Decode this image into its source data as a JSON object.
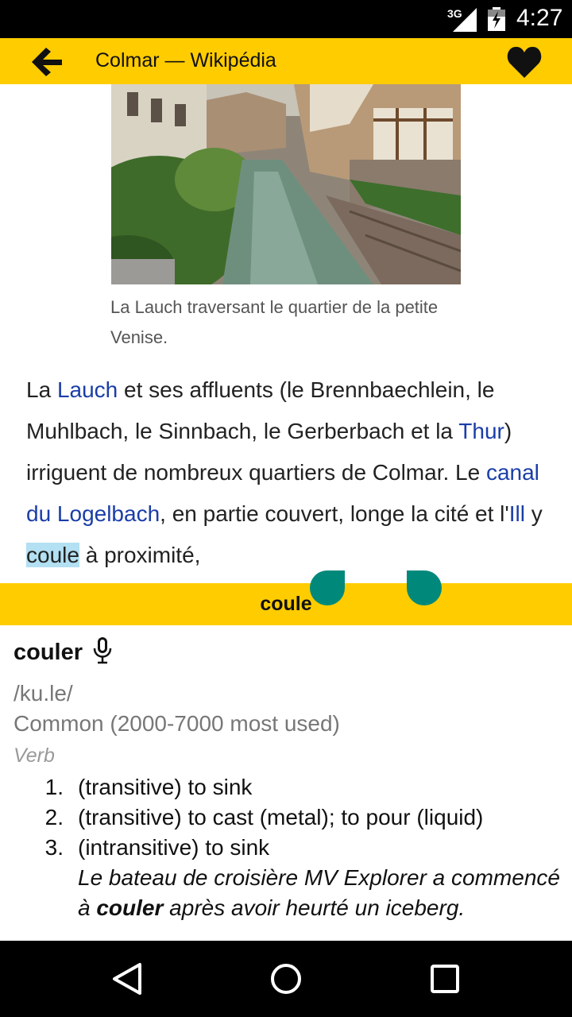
{
  "status_bar": {
    "network": "3G",
    "time": "4:27"
  },
  "toolbar": {
    "title": "Colmar — Wikipédia"
  },
  "article": {
    "caption": "La Lauch traversant le quartier de la petite Venise.",
    "para": {
      "t1": "La ",
      "link1": "Lauch",
      "t2": " et ses affluents (le Brennbaechlein, le Muhlbach, le Sinnbach, le Gerberbach et la ",
      "link2": "Thur",
      "t3": ") irriguent de nombreux quartiers de Colmar. Le ",
      "link3": "canal du Logelbach",
      "t4": ", en partie couvert, longe la cité et l'",
      "link4": "Ill",
      "t5": " y ",
      "selected": "coule",
      "t6": " à proximité,"
    }
  },
  "dictionary": {
    "query": "coule",
    "headword": "couler",
    "pronunciation": "/ku.le/",
    "frequency": "Common (2000-7000 most used)",
    "part_of_speech": "Verb",
    "definitions": [
      {
        "num": "1.",
        "text": "(transitive) to sink"
      },
      {
        "num": "2.",
        "text": "(transitive) to cast (metal); to pour (liquid)"
      },
      {
        "num": "3.",
        "text": "(intransitive) to sink"
      }
    ],
    "example": {
      "before": "Le bateau de croisière MV Explorer a commencé à ",
      "bold": "couler",
      "after": " après avoir heurté un iceberg."
    }
  },
  "colors": {
    "accent": "#ffcc00",
    "link": "#1a3ea7",
    "handle": "#00897b",
    "selection": "#b3e0f2"
  }
}
